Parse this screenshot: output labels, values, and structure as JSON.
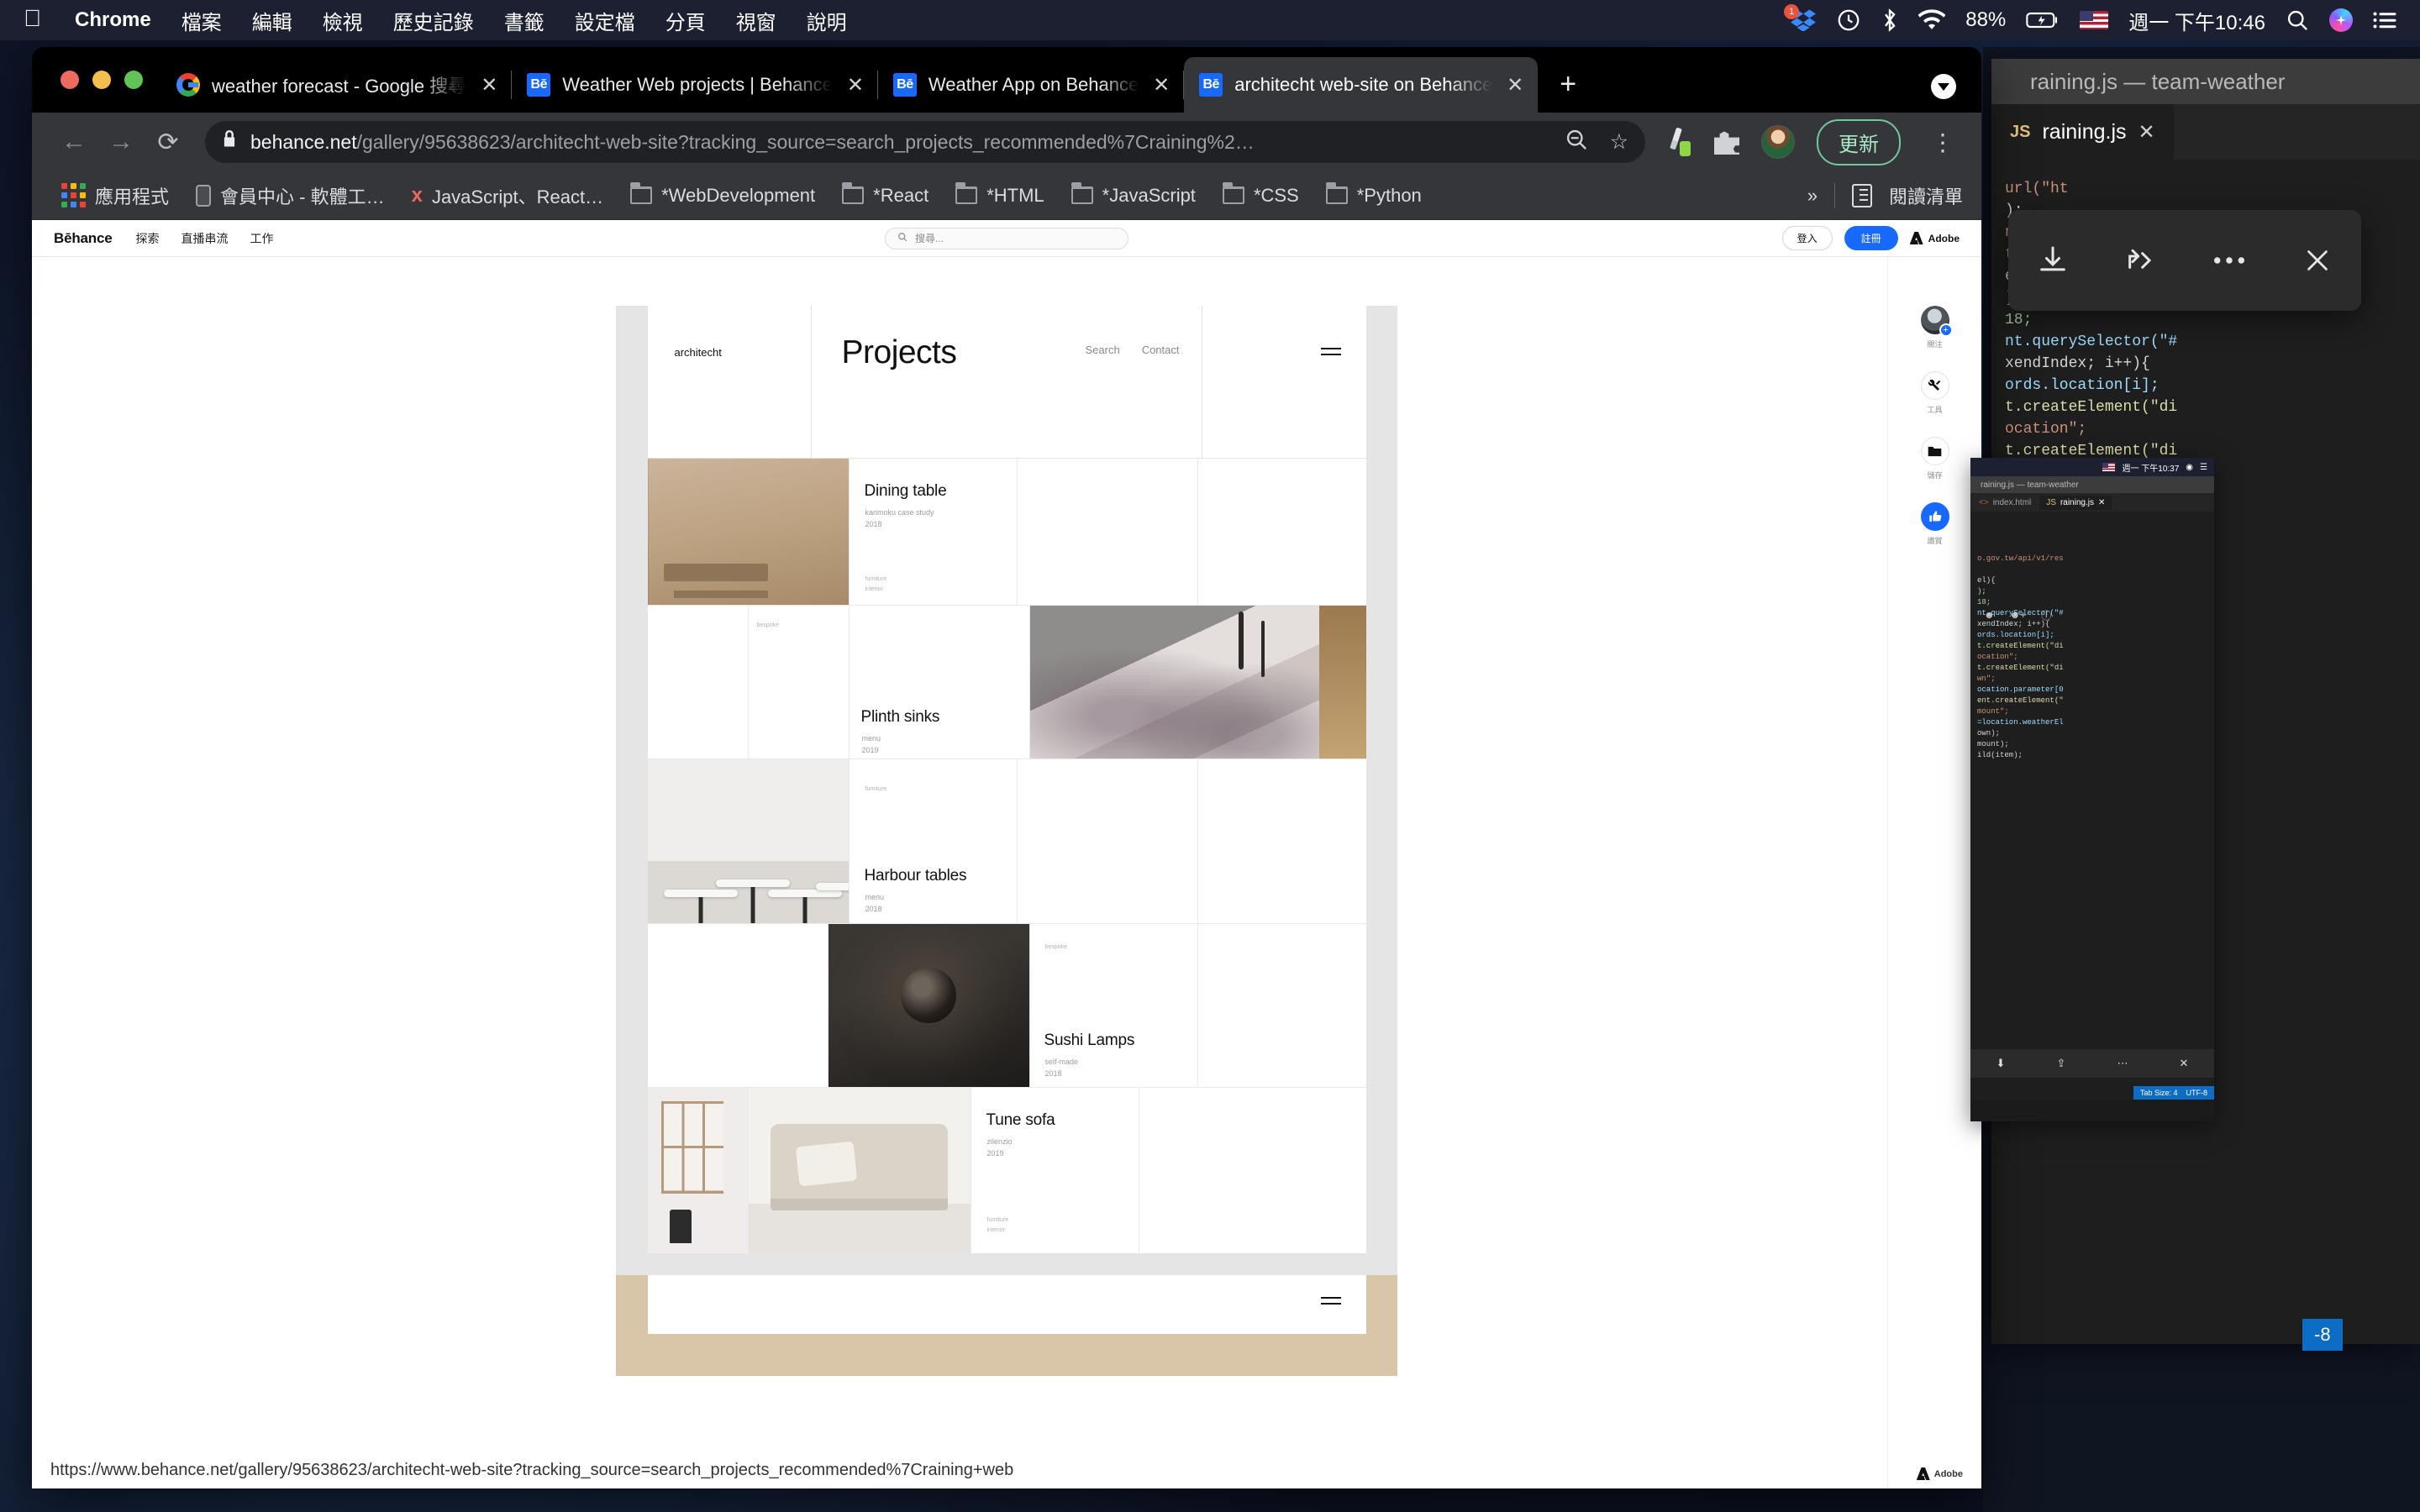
{
  "menubar": {
    "apple_icon": "apple-logo",
    "items": [
      {
        "label": "Chrome",
        "bold": true
      },
      {
        "label": "檔案",
        "bold": false
      },
      {
        "label": "編輯",
        "bold": false
      },
      {
        "label": "檢視",
        "bold": false
      },
      {
        "label": "歷史記錄",
        "bold": false
      },
      {
        "label": "書籤",
        "bold": false
      },
      {
        "label": "設定檔",
        "bold": false
      },
      {
        "label": "分頁",
        "bold": false
      },
      {
        "label": "視窗",
        "bold": false
      },
      {
        "label": "說明",
        "bold": false
      }
    ],
    "tray": {
      "dropbox_badge": "1",
      "battery_percent": "88%",
      "datetime": "週一 下午10:46",
      "input_source": "us-flag",
      "icons": [
        "dropbox-icon",
        "time-machine-icon",
        "bluetooth-icon",
        "wifi-icon",
        "battery-icon",
        "flag-icon",
        "spotlight-search-icon",
        "siri-icon",
        "control-center-icon"
      ]
    }
  },
  "chrome": {
    "tabs": [
      {
        "title": "weather forecast - Google 搜尋",
        "favicon": "google-icon",
        "active": false
      },
      {
        "title": "Weather Web projects | Behance",
        "favicon": "behance-icon",
        "active": false
      },
      {
        "title": "Weather App on Behance",
        "favicon": "behance-icon",
        "active": false
      },
      {
        "title": "architecht web-site on Behance",
        "favicon": "behance-icon",
        "active": true
      }
    ],
    "new_tab_label": "+",
    "toolbar": {
      "back": "←",
      "forward": "→",
      "reload": "⟳",
      "lock_icon": "lock-icon",
      "url_domain": "behance.net",
      "url_path": "/gallery/95638623/architecht-web-site?tracking_source=search_projects_recommended%7Craining%2…",
      "zoom_out_icon": "zoom-out-icon",
      "bookmark_star": "☆",
      "update_button": "更新",
      "menu_icon": "kebab-menu-icon"
    },
    "bookmarks": [
      {
        "label": "應用程式",
        "icon": "apps-grid-icon"
      },
      {
        "label": "會員中心 - 軟體工…",
        "icon": "phone-icon"
      },
      {
        "label": "JavaScript、React…",
        "icon": "udemy-icon"
      },
      {
        "label": "*WebDevelopment",
        "icon": "folder-icon"
      },
      {
        "label": "*React",
        "icon": "folder-icon"
      },
      {
        "label": "*HTML",
        "icon": "folder-icon"
      },
      {
        "label": "*JavaScript",
        "icon": "folder-icon"
      },
      {
        "label": "*CSS",
        "icon": "folder-icon"
      },
      {
        "label": "*Python",
        "icon": "folder-icon"
      }
    ],
    "bookmarks_overflow": "»",
    "reading_list": "閱讀清單",
    "status_url": "https://www.behance.net/gallery/95638623/architecht-web-site?tracking_source=search_projects_recommended%7Craining+web"
  },
  "behance": {
    "logo": "Bēhance",
    "nav": [
      "探索",
      "直播串流",
      "工作"
    ],
    "search_placeholder": "搜尋...",
    "sign_in": "登入",
    "sign_up": "註冊",
    "adobe": "Adobe",
    "footer_adobe": "Adobe",
    "rail": [
      {
        "label": "關注",
        "icon": "avatar-follow-icon"
      },
      {
        "label": "工具",
        "icon": "tools-icon"
      },
      {
        "label": "儲存",
        "icon": "folder-save-icon"
      },
      {
        "label": "讚賞",
        "icon": "thumbs-up-icon"
      }
    ]
  },
  "project": {
    "site": {
      "brand": "architecht",
      "title": "Projects",
      "links": [
        "Search",
        "Contact"
      ],
      "menu_icon": "hamburger-icon"
    },
    "items": [
      {
        "title": "Dining table",
        "client": "karimoku case study",
        "year": "2018",
        "tags": "furniture\ninterior"
      },
      {
        "title": "Plinth sinks",
        "client": "menu",
        "year": "2019",
        "tags": "bespoke"
      },
      {
        "title": "Harbour tables",
        "client": "menu",
        "year": "2018",
        "tags": "furniture"
      },
      {
        "title": "Sushi Lamps",
        "client": "self-made",
        "year": "2018",
        "tags": "bespoke"
      },
      {
        "title": "Tune sofa",
        "client": "zilenzio",
        "year": "2019",
        "tags": "furniture\ninterior"
      }
    ]
  },
  "vscode": {
    "window_title": "raining.js — team-weather",
    "tab_label": "raining.js",
    "tab_lang": "JS",
    "close_icon": "close-icon",
    "code": [
      "url(\"ht",
      ");",
      "n(\"d",
      "",
      "t(\"d",
      "",
      "el){",
      ");",
      "18;",
      "nt.querySelector(\"#",
      "xendIndex; i++){",
      "ords.location[i];",
      "t.createElement(\"di",
      "ocation\";",
      "t.createElement(\"di",
      "wn\";",
      "ocation.parameter[0",
      "ent.createElement(\"",
      "mount\";",
      "=location.weatherEl",
      "own);",
      "mount);",
      "ild(item);"
    ]
  },
  "mini_window": {
    "time": "週一 下午10:37",
    "title": "raining.js — team-weather",
    "tabs": [
      {
        "label": "index.html",
        "icon": "html-icon"
      },
      {
        "label": "raining.js",
        "icon": "js-icon",
        "close": "close-icon"
      }
    ],
    "url_fragment": "o.gov.tw/api/v1/res",
    "status": [
      "Tab Size: 4",
      "UTF-8"
    ]
  },
  "overlay": {
    "toolbar_icons": [
      "download-icon",
      "share-icon",
      "more-icon",
      "close-icon"
    ],
    "blue_chip": "-8"
  },
  "colors": {
    "accent_blue": "#1769ff",
    "chrome_toolbar": "#35363a",
    "tab_active": "#35363a",
    "update_green": "#74c79a",
    "vscode_bg": "#1e1e1e",
    "status_blue": "#0d6cc4"
  }
}
